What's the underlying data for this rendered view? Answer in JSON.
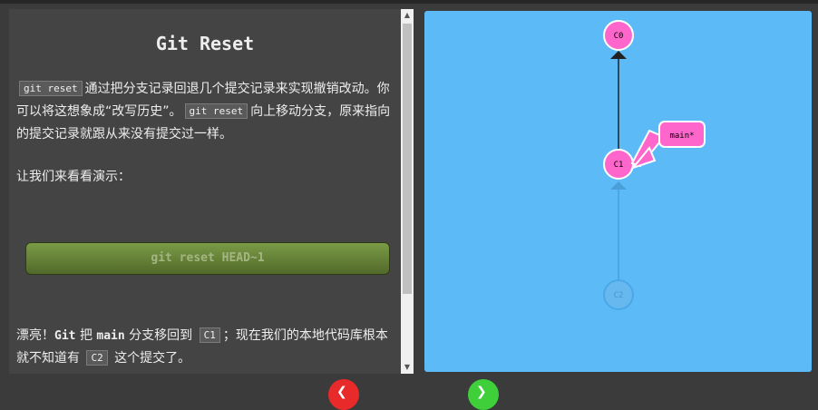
{
  "lesson": {
    "title": "Git Reset",
    "p1": {
      "code1": "git reset",
      "text1": "通过把分支记录回退几个提交记录来实现撤销改动。你可以将这想象成“改写历史”。",
      "code2": "git reset",
      "text2": "向上移动分支，原来指向的提交记录就跟从来没有提交过一样。"
    },
    "p2": "让我们来看看演示：",
    "command_button": "git reset HEAD~1",
    "p3": {
      "text1": "漂亮！",
      "bold1": "Git",
      "text2": "把",
      "bold2": "main",
      "text3": "分支移回到",
      "code1": "C1",
      "text4": "；现在我们的本地代码库根本就不知道有",
      "code2": "C2",
      "text5": "这个提交了。"
    }
  },
  "visualization": {
    "background": "#5cbaf7",
    "commits": [
      {
        "id": "C0",
        "state": "active"
      },
      {
        "id": "C1",
        "state": "active"
      },
      {
        "id": "C2",
        "state": "faded"
      }
    ],
    "branch_label": "main*",
    "commit_color": "#ff66cc"
  },
  "nav": {
    "prev_icon": "chevron-left-icon",
    "next_icon": "chevron-right-icon"
  }
}
